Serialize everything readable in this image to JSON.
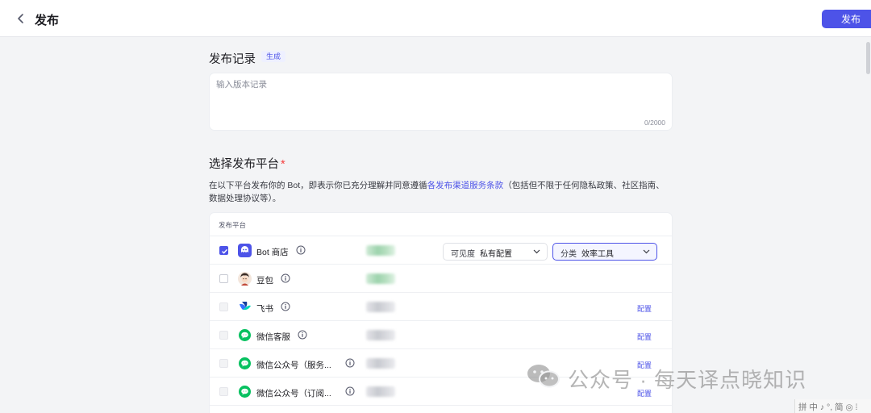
{
  "header": {
    "title": "发布",
    "publish_label": "发布"
  },
  "release_notes": {
    "title": "发布记录",
    "generate_label": "生成",
    "placeholder": "输入版本记录",
    "counter": "0/2000"
  },
  "platforms": {
    "title": "选择发布平台",
    "required_mark": "*",
    "description_before": "在以下平台发布你的 Bot，即表示你已充分理解并同意遵循",
    "description_link": "各发布渠道服务条款",
    "description_after": "（包括但不限于任何隐私政策、社区指南、数据处理协议等）。",
    "column_header": "发布平台",
    "config_label": "配置",
    "visibility": {
      "label": "可见度",
      "value": "私有配置"
    },
    "category": {
      "label": "分类",
      "value": "效率工具"
    },
    "rows": [
      {
        "name": "Bot 商店",
        "checked": true,
        "icon": "bot-store-icon"
      },
      {
        "name": "豆包",
        "checked": false,
        "icon": "doubao-avatar-icon"
      },
      {
        "name": "飞书",
        "checked": false,
        "icon": "feishu-icon"
      },
      {
        "name": "微信客服",
        "checked": false,
        "icon": "wechat-icon"
      },
      {
        "name": "微信公众号（服务...",
        "checked": false,
        "icon": "wechat-icon"
      },
      {
        "name": "微信公众号（订阅...",
        "checked": false,
        "icon": "wechat-icon"
      }
    ]
  },
  "watermark": {
    "text": "公众号 · 每天译点晓知识"
  },
  "ime_bar": {
    "text": "拼 中 ♪ °, 简 ◎ ⁞"
  },
  "colors": {
    "accent": "#4d53e8",
    "required": "#f53f3f",
    "wechat": "#07c160"
  }
}
